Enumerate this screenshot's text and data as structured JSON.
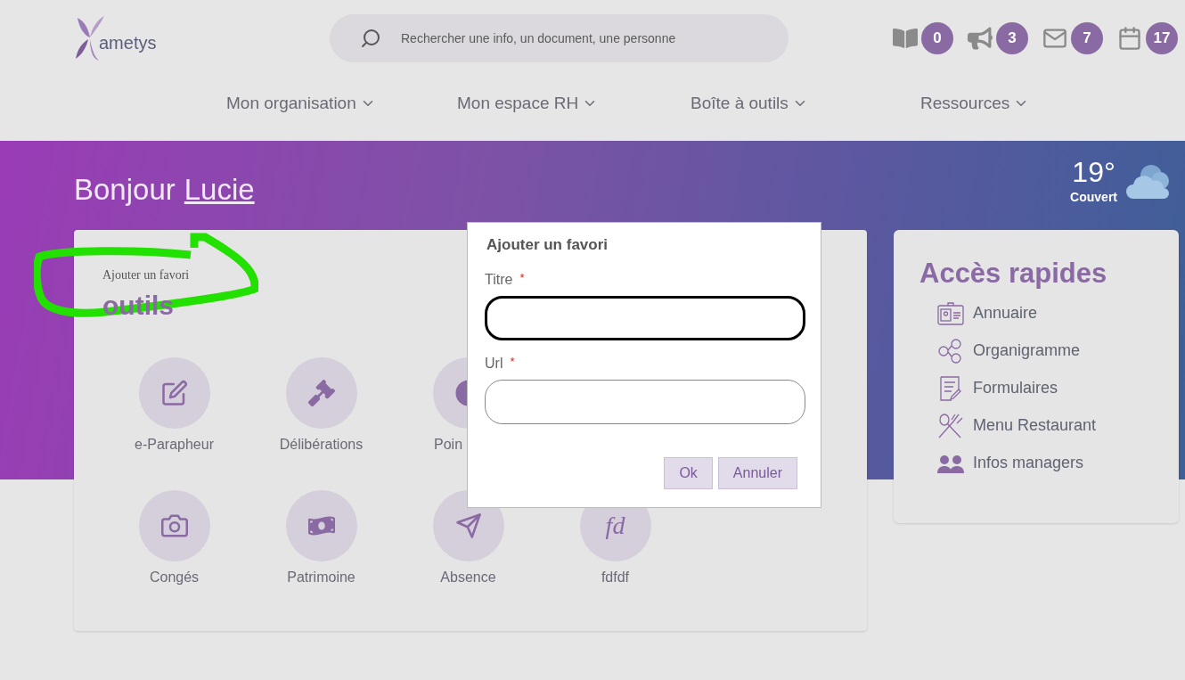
{
  "header": {
    "logo": "ametys",
    "search": {
      "placeholder": "Rechercher une info, un document, une personne"
    },
    "notifications": [
      {
        "count": "0"
      },
      {
        "count": "3"
      },
      {
        "count": "7"
      },
      {
        "count": "17"
      }
    ]
  },
  "nav": [
    {
      "label": "Mon organisation"
    },
    {
      "label": "Mon espace RH"
    },
    {
      "label": "Boîte à outils"
    },
    {
      "label": "Ressources"
    }
  ],
  "hero": {
    "greeting": "Bonjour",
    "name": "Lucie",
    "weather": {
      "temperature": "19°",
      "condition": "Couvert"
    }
  },
  "tools_card": {
    "note": "Ajouter un favori",
    "title": "outils",
    "tiles": [
      {
        "kind": "icon",
        "label": "e-Parapheur"
      },
      {
        "kind": "icon",
        "label": "Délibérations"
      },
      {
        "kind": "icon",
        "label": "Poin",
        "cut": true
      },
      {
        "kind": "hidden"
      },
      {
        "kind": "icon",
        "label": "Congés"
      },
      {
        "kind": "icon",
        "label": "Patrimoine"
      },
      {
        "kind": "icon",
        "label": "Absence"
      },
      {
        "kind": "text",
        "icon_text": "fd",
        "label": "fdfdf"
      }
    ]
  },
  "quick_access": {
    "title": "Accès rapides",
    "items": [
      {
        "label": "Annuaire"
      },
      {
        "label": "Organigramme"
      },
      {
        "label": "Formulaires"
      },
      {
        "label": "Menu Restaurant"
      },
      {
        "label": "Infos managers"
      }
    ]
  },
  "dialog": {
    "title": "Ajouter un favori",
    "fields": [
      {
        "label": "Titre",
        "required": "*",
        "focused": true
      },
      {
        "label": "Url",
        "required": "*",
        "focused": false
      }
    ],
    "buttons": [
      {
        "label": "Ok"
      },
      {
        "label": "Annuler"
      }
    ]
  }
}
